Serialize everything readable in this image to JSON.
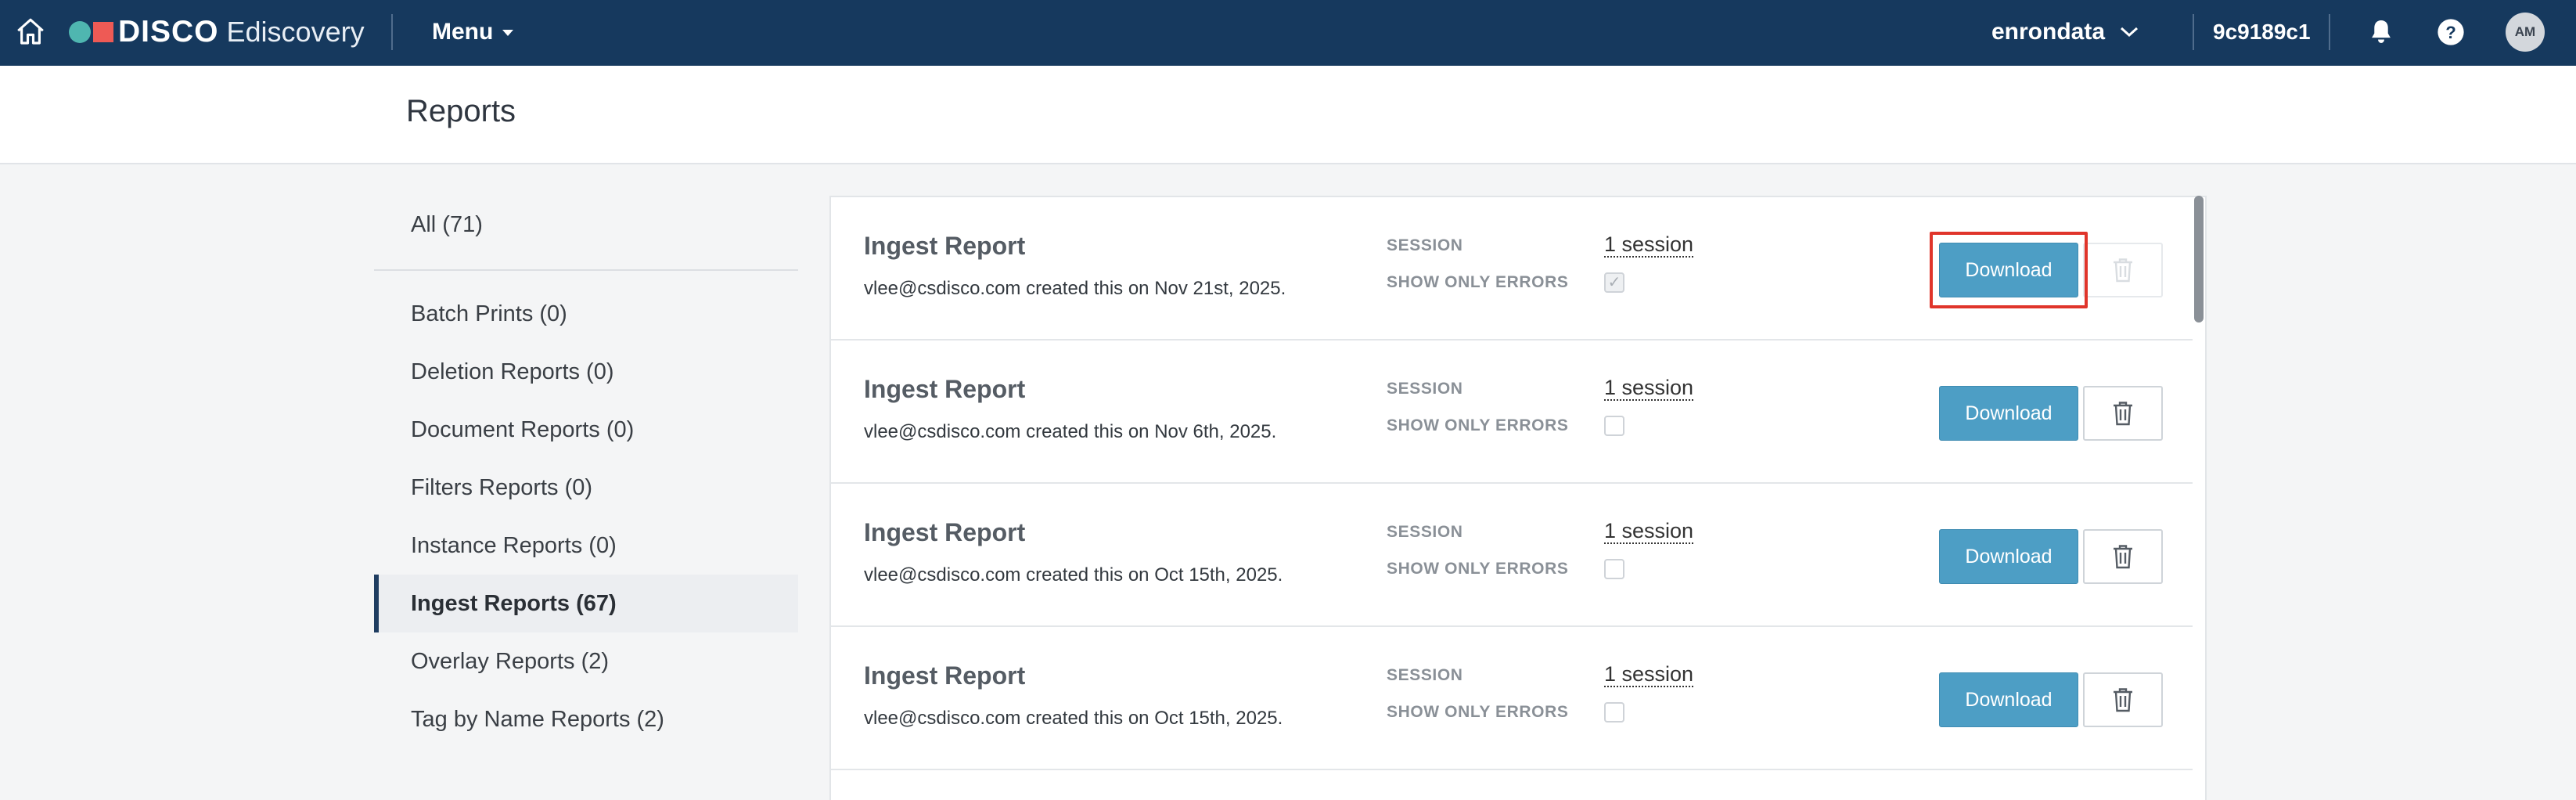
{
  "topbar": {
    "brand": "DISCO",
    "product": "Ediscovery",
    "menu_label": "Menu",
    "project_name": "enrondata",
    "user_id": "9c9189c1",
    "avatar_initials": "AM",
    "bar_color": "#16395e"
  },
  "page": {
    "title": "Reports"
  },
  "sidebar": {
    "all": "All (71)",
    "items": [
      {
        "label": "Batch Prints (0)"
      },
      {
        "label": "Deletion Reports (0)"
      },
      {
        "label": "Document Reports (0)"
      },
      {
        "label": "Filters Reports (0)"
      },
      {
        "label": "Instance Reports (0)"
      },
      {
        "label": "Ingest Reports (67)"
      },
      {
        "label": "Overlay Reports (2)"
      },
      {
        "label": "Tag by Name Reports (2)"
      }
    ]
  },
  "labels": {
    "session": "SESSION",
    "show_only_errors": "SHOW ONLY ERRORS",
    "download": "Download"
  },
  "reports": [
    {
      "title": "Ingest Report",
      "meta": "vlee@csdisco.com created this on Nov 21st, 2025.",
      "session": "1 session",
      "show_only_errors": true
    },
    {
      "title": "Ingest Report",
      "meta": "vlee@csdisco.com created this on Nov 6th, 2025.",
      "session": "1 session",
      "show_only_errors": false
    },
    {
      "title": "Ingest Report",
      "meta": "vlee@csdisco.com created this on Oct 15th, 2025.",
      "session": "1 session",
      "show_only_errors": false
    },
    {
      "title": "Ingest Report",
      "meta": "vlee@csdisco.com created this on Oct 15th, 2025.",
      "session": "1 session",
      "show_only_errors": false
    }
  ]
}
